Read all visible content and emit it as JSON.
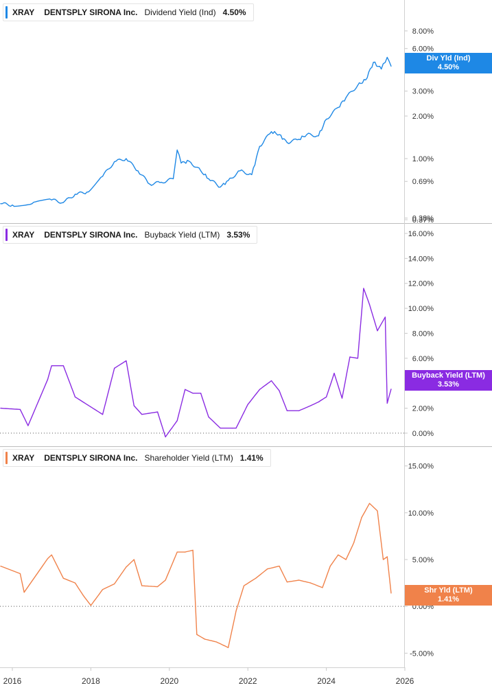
{
  "legend": [
    {
      "ticker": "XRAY",
      "company": "DENTSPLY SIRONA Inc.",
      "metric": "Dividend Yield (Ind)",
      "value": "4.50%"
    },
    {
      "ticker": "XRAY",
      "company": "DENTSPLY SIRONA Inc.",
      "metric": "Buyback Yield (LTM)",
      "value": "3.53%"
    },
    {
      "ticker": "XRAY",
      "company": "DENTSPLY SIRONA Inc.",
      "metric": "Shareholder Yield (LTM)",
      "value": "1.41%"
    }
  ],
  "tags": [
    {
      "line1": "Div Yld (Ind)",
      "line2": "4.50%"
    },
    {
      "line1": "Buyback Yield (LTM)",
      "line2": "3.53%"
    },
    {
      "line1": "Shr Yld (LTM)",
      "line2": "1.41%"
    }
  ],
  "colors": {
    "dividend": "#1e88e5",
    "buyback": "#8a2be2",
    "shareholder": "#f0824a",
    "axis": "#888888",
    "grid_zero": "#555555"
  },
  "x_axis": {
    "ticks": [
      "2016",
      "2018",
      "2020",
      "2022",
      "2024",
      "2026"
    ]
  },
  "chart_data": [
    {
      "type": "line",
      "series": [
        {
          "name": "Dividend Yield (Ind)",
          "x": [
            2015.7,
            2016.0,
            2016.5,
            2017.0,
            2017.3,
            2017.6,
            2017.9,
            2018.3,
            2018.6,
            2018.9,
            2019.2,
            2019.5,
            2019.8,
            2020.1,
            2020.2,
            2020.3,
            2020.5,
            2020.8,
            2021.0,
            2021.3,
            2021.5,
            2021.8,
            2022.1,
            2022.3,
            2022.6,
            2022.8,
            2023.0,
            2023.3,
            2023.5,
            2023.8,
            2024.0,
            2024.3,
            2024.5,
            2024.8,
            2025.0,
            2025.2,
            2025.4,
            2025.55,
            2025.65
          ],
          "y": [
            0.48,
            0.47,
            0.48,
            0.51,
            0.49,
            0.56,
            0.58,
            0.75,
            0.95,
            1.0,
            0.82,
            0.66,
            0.68,
            0.72,
            1.15,
            0.93,
            0.96,
            0.82,
            0.72,
            0.63,
            0.7,
            0.82,
            0.77,
            1.22,
            1.55,
            1.48,
            1.3,
            1.37,
            1.48,
            1.45,
            1.9,
            2.3,
            2.7,
            3.3,
            3.6,
            4.8,
            4.3,
            5.2,
            4.5
          ]
        }
      ],
      "yticks": [
        "0.37%",
        "0.38%",
        "0.69%",
        "1.00%",
        "2.00%",
        "3.00%",
        "6.00%",
        "8.00%"
      ],
      "scale": "log"
    },
    {
      "type": "line",
      "series": [
        {
          "name": "Buyback Yield (LTM)",
          "x": [
            2015.7,
            2016.2,
            2016.4,
            2016.9,
            2017.0,
            2017.3,
            2017.6,
            2017.8,
            2018.3,
            2018.6,
            2018.9,
            2019.1,
            2019.3,
            2019.7,
            2019.9,
            2020.2,
            2020.4,
            2020.6,
            2020.8,
            2021.0,
            2021.3,
            2021.6,
            2021.7,
            2022.0,
            2022.3,
            2022.6,
            2022.8,
            2023.0,
            2023.3,
            2023.6,
            2023.8,
            2024.0,
            2024.2,
            2024.4,
            2024.6,
            2024.8,
            2024.95,
            2025.1,
            2025.3,
            2025.5,
            2025.55,
            2025.65
          ],
          "y": [
            2.0,
            1.9,
            0.6,
            4.3,
            5.4,
            5.4,
            2.9,
            2.5,
            1.5,
            5.2,
            5.8,
            2.2,
            1.5,
            1.7,
            -0.3,
            1.0,
            3.5,
            3.2,
            3.2,
            1.3,
            0.4,
            0.4,
            0.4,
            2.3,
            3.5,
            4.2,
            3.4,
            1.8,
            1.8,
            2.2,
            2.5,
            2.9,
            4.8,
            2.8,
            6.1,
            6.0,
            11.6,
            10.3,
            8.2,
            9.3,
            2.4,
            3.53
          ]
        }
      ],
      "yticks": [
        "0.00%",
        "2.00%",
        "4.00%",
        "6.00%",
        "8.00%",
        "10.00%",
        "12.00%",
        "14.00%",
        "16.00%"
      ]
    },
    {
      "type": "line",
      "series": [
        {
          "name": "Shareholder Yield (LTM)",
          "x": [
            2015.7,
            2016.2,
            2016.3,
            2016.9,
            2017.0,
            2017.3,
            2017.6,
            2017.8,
            2018.0,
            2018.3,
            2018.6,
            2018.9,
            2019.1,
            2019.3,
            2019.7,
            2019.9,
            2020.2,
            2020.4,
            2020.6,
            2020.7,
            2020.9,
            2021.2,
            2021.5,
            2021.7,
            2021.9,
            2022.2,
            2022.5,
            2022.8,
            2023.0,
            2023.3,
            2023.6,
            2023.9,
            2024.1,
            2024.3,
            2024.5,
            2024.7,
            2024.9,
            2025.1,
            2025.3,
            2025.45,
            2025.55,
            2025.65
          ],
          "y": [
            4.3,
            3.5,
            1.5,
            5.1,
            5.5,
            3.0,
            2.5,
            1.2,
            0.1,
            1.8,
            2.4,
            4.2,
            5.0,
            2.2,
            2.1,
            2.8,
            5.8,
            5.8,
            6.0,
            -3.0,
            -3.5,
            -3.8,
            -4.4,
            -0.5,
            2.2,
            3.0,
            4.0,
            4.3,
            2.6,
            2.8,
            2.5,
            2.0,
            4.3,
            5.5,
            5.0,
            6.8,
            9.5,
            11.0,
            10.2,
            5.0,
            5.3,
            1.41
          ]
        }
      ],
      "yticks": [
        "-5.00%",
        "0.00%",
        "5.00%",
        "10.00%",
        "15.00%"
      ]
    }
  ]
}
